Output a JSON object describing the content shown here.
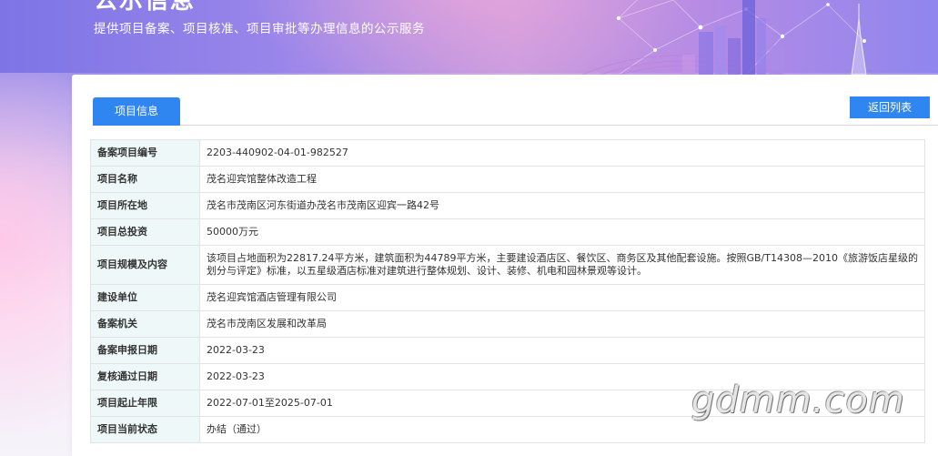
{
  "hero": {
    "title": "公示信息",
    "subtitle": "提供项目备案、项目核准、项目审批等办理信息的公示服务"
  },
  "tabs": [
    {
      "label": "项目信息",
      "active": true
    }
  ],
  "back_button_label": "返回列表",
  "rows": [
    {
      "label": "备案项目编号",
      "value": "2203-440902-04-01-982527"
    },
    {
      "label": "项目名称",
      "value": "茂名迎宾馆整体改造工程"
    },
    {
      "label": "项目所在地",
      "value": "茂名市茂南区河东街道办茂名市茂南区迎宾一路42号"
    },
    {
      "label": "项目总投资",
      "value": "50000万元"
    },
    {
      "label": "项目规模及内容",
      "value": "该项目占地面积为22817.24平方米，建筑面积为44789平方米，主要建设酒店区、餐饮区、商务区及其他配套设施。按照GB/T14308—2010《旅游饭店星级的划分与评定》标准，以五星级酒店标准对建筑进行整体规划、设计、装修、机电和园林景观等设计。"
    },
    {
      "label": "建设单位",
      "value": "茂名迎宾馆酒店管理有限公司"
    },
    {
      "label": "备案机关",
      "value": "茂名市茂南区发展和改革局"
    },
    {
      "label": "备案申报日期",
      "value": "2022-03-23"
    },
    {
      "label": "复核通过日期",
      "value": "2022-03-23"
    },
    {
      "label": "项目起止年限",
      "value": "2022-07-01至2025-07-01"
    },
    {
      "label": "项目当前状态",
      "value": "办结（通过）"
    }
  ],
  "watermark": "gdmm.com",
  "colors": {
    "accent": "#2f86f0",
    "label_bg": "#eef8f8",
    "border": "#e3e3e3"
  }
}
